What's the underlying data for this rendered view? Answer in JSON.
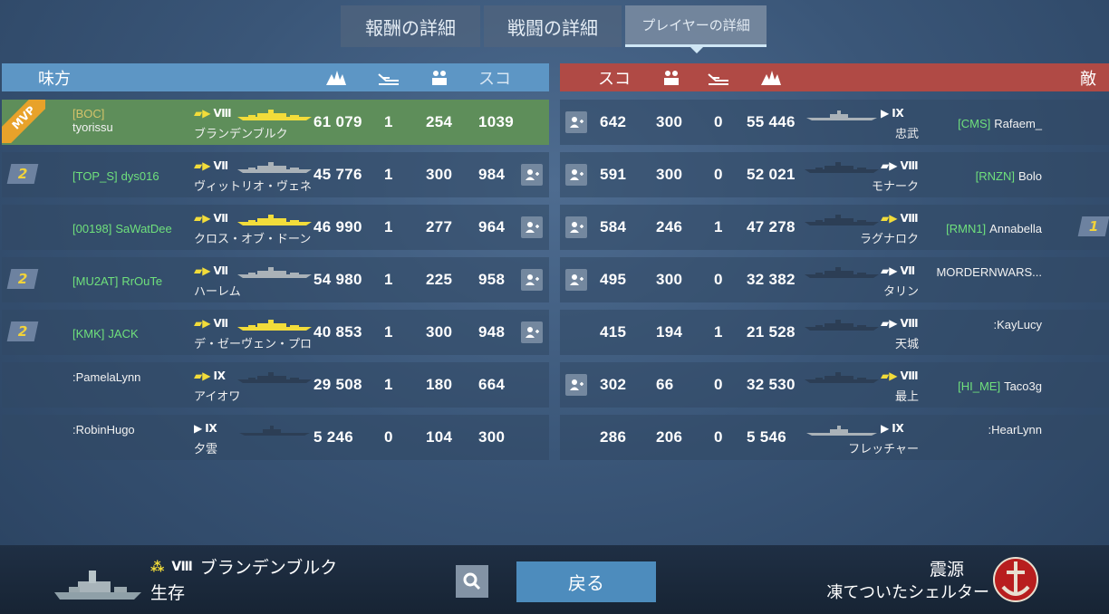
{
  "tabs": [
    "報酬の詳細",
    "戦闘の詳細",
    "プレイヤーの詳細"
  ],
  "ally_header": {
    "title": "味方",
    "score_label": "スコ"
  },
  "enemy_header": {
    "title": "敵",
    "score_label": "スコ"
  },
  "header_icons": [
    "damage-icon",
    "kills-icon",
    "xp-icon"
  ],
  "allies": [
    {
      "mvp": true,
      "mvp_label": "MVP",
      "division": "",
      "clan": "[BOC]",
      "name": "tyorissu",
      "tier": "Ⅷ",
      "ship": "ブランデンブルク",
      "damage": "61 079",
      "kills": "1",
      "xp": "254",
      "score": "1039",
      "add": false,
      "highlight": true
    },
    {
      "division": "2",
      "clan": "[TOP_S]",
      "name": "dys016",
      "tier": "Ⅶ",
      "ship": "ヴィットリオ・ヴェネ",
      "damage": "45 776",
      "kills": "1",
      "xp": "300",
      "score": "984",
      "add": true
    },
    {
      "division": "",
      "clan": "[00198]",
      "name": "SaWatDee",
      "tier": "Ⅶ",
      "ship": "クロス・オブ・ドーン",
      "damage": "46 990",
      "kills": "1",
      "xp": "277",
      "score": "964",
      "add": true
    },
    {
      "division": "2",
      "clan": "[MU2AT]",
      "name": "RrOuTe",
      "tier": "Ⅶ",
      "ship": "ハーレム",
      "damage": "54 980",
      "kills": "1",
      "xp": "225",
      "score": "958",
      "add": true
    },
    {
      "division": "2",
      "clan": "[KMK]",
      "name": "JACK",
      "tier": "Ⅶ",
      "ship": "デ・ゼーヴェン・プロ",
      "damage": "40 853",
      "kills": "1",
      "xp": "300",
      "score": "948",
      "add": true
    },
    {
      "division": "",
      "clan": "",
      "name": ":PamelaLynn",
      "tier": "Ⅸ",
      "ship": "アイオワ",
      "damage": "29 508",
      "kills": "1",
      "xp": "180",
      "score": "664",
      "add": false
    },
    {
      "division": "",
      "clan": "",
      "name": ":RobinHugo",
      "tier": "Ⅸ",
      "ship": "夕雲",
      "damage": "5 246",
      "kills": "0",
      "xp": "104",
      "score": "300",
      "add": false,
      "dd": true
    }
  ],
  "enemies": [
    {
      "add": true,
      "score": "642",
      "xp": "300",
      "kills": "0",
      "damage": "55 446",
      "tier": "Ⅸ",
      "ship": "忠武",
      "clan": "[CMS]",
      "name": "Rafaem_",
      "division": "",
      "dd": true
    },
    {
      "add": true,
      "score": "591",
      "xp": "300",
      "kills": "0",
      "damage": "52 021",
      "tier": "Ⅷ",
      "ship": "モナーク",
      "clan": "[RNZN]",
      "name": "Bolo",
      "division": ""
    },
    {
      "add": true,
      "score": "584",
      "xp": "246",
      "kills": "1",
      "damage": "47 278",
      "tier": "Ⅷ",
      "ship": "ラグナロク",
      "clan": "[RMN1]",
      "name": "Annabella",
      "division": "1",
      "gold": true
    },
    {
      "add": true,
      "score": "495",
      "xp": "300",
      "kills": "0",
      "damage": "32 382",
      "tier": "Ⅶ",
      "ship": "タリン",
      "clan": "",
      "name": "MORDERNWARS...",
      "division": ""
    },
    {
      "add": false,
      "score": "415",
      "xp": "194",
      "kills": "1",
      "damage": "21 528",
      "tier": "Ⅷ",
      "ship": "天城",
      "clan": "",
      "name": ":KayLucy",
      "division": ""
    },
    {
      "add": true,
      "score": "302",
      "xp": "66",
      "kills": "0",
      "damage": "32 530",
      "tier": "Ⅷ",
      "ship": "最上",
      "clan": "[HI_ME]",
      "name": "Taco3g",
      "division": "",
      "gold": true
    },
    {
      "add": false,
      "score": "286",
      "xp": "206",
      "kills": "0",
      "damage": "5 546",
      "tier": "Ⅸ",
      "ship": "フレッチャー",
      "clan": "",
      "name": ":HearLynn",
      "division": "",
      "dd": true
    }
  ],
  "footer": {
    "tier": "Ⅷ",
    "ship": "ブランデンブルク",
    "status": "生存",
    "back": "戻る",
    "achievement": "震源",
    "achievement_sub": "凍てついたシェルター"
  },
  "colors": {
    "ally": "#5d96c5",
    "enemy": "#b04a45",
    "mvp_row": "#5e8e5a",
    "clan": "#6fe07c",
    "gold": "#f2dc3a"
  }
}
